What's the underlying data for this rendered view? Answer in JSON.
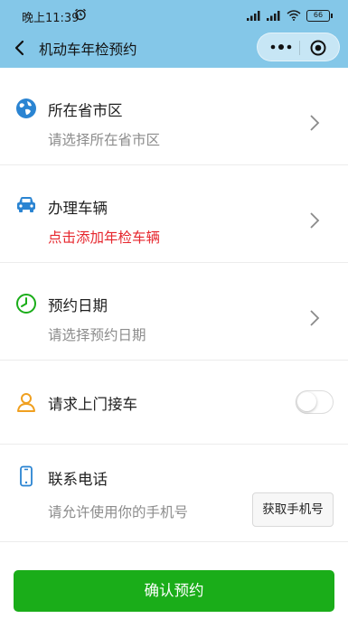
{
  "status_bar": {
    "time": "晚上11:39",
    "battery": "66"
  },
  "navbar": {
    "title": "机动车年检预约"
  },
  "rows": [
    {
      "label": "所在省市区",
      "sub": "请选择所在省市区"
    },
    {
      "label": "办理车辆",
      "sub": "点击添加年检车辆"
    },
    {
      "label": "预约日期",
      "sub": "请选择预约日期"
    },
    {
      "label": "请求上门接车"
    },
    {
      "label": "联系电话",
      "sub": "请允许使用你的手机号"
    }
  ],
  "get_phone_button": "获取手机号",
  "confirm_button": "确认预约",
  "pickup_toggle_on": false,
  "colors": {
    "header": "#84c7e8",
    "accent_red": "#e6262d",
    "primary_green": "#1aad19",
    "icon_blue": "#2a84d2",
    "icon_green": "#1aad19",
    "icon_orange": "#f0a020"
  }
}
